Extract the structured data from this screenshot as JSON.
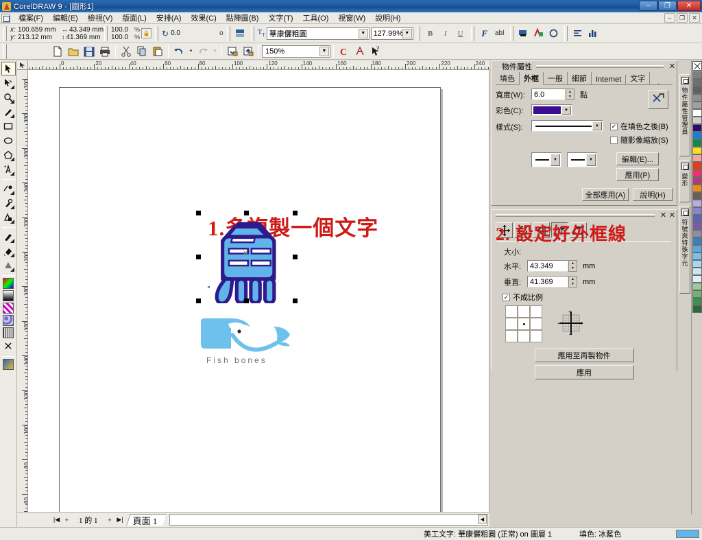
{
  "window": {
    "title": "CorelDRAW 9 - [圖形1]",
    "minimize": "–",
    "restore": "❐",
    "close": "✕",
    "mdi_minimize": "–",
    "mdi_restore": "❐",
    "mdi_close": "✕"
  },
  "menu": {
    "items": [
      {
        "label": "檔案(F)"
      },
      {
        "label": "編輯(E)"
      },
      {
        "label": "檢視(V)"
      },
      {
        "label": "版面(L)"
      },
      {
        "label": "安排(A)"
      },
      {
        "label": "效果(C)"
      },
      {
        "label": "點陣圖(B)"
      },
      {
        "label": "文字(T)"
      },
      {
        "label": "工具(O)"
      },
      {
        "label": "視窗(W)"
      },
      {
        "label": "說明(H)"
      }
    ]
  },
  "property_bar": {
    "x_label": "x:",
    "y_label": "y:",
    "x_value": "100.659 mm",
    "y_value": "213.12 mm",
    "width_value": "43.349 mm",
    "height_value": "41.369 mm",
    "scale_h": "100.0",
    "scale_v": "100.0",
    "percent": "%",
    "rotation": "0.0",
    "degree": "o",
    "font_name": "華康儷粗圓",
    "font_size": "127.99%",
    "bold": "B",
    "italic": "I",
    "underline": "U",
    "format_text": "F",
    "edit_text": "abl",
    "dropdown": "▼"
  },
  "standard_bar": {
    "new": "new-file",
    "open": "open-file",
    "save": "save-file",
    "print": "print",
    "cut": "cut",
    "copy": "copy",
    "paste": "paste",
    "undo": "undo",
    "redo": "redo",
    "import": "import",
    "export": "export",
    "zoom_level": "150%",
    "app_launcher": "corel-apps",
    "scrapbook": "scrapbook",
    "whats_this": "whats-this"
  },
  "toolbox": {
    "tools": [
      {
        "name": "pick-tool",
        "glyph": "➤"
      },
      {
        "name": "shape-tool",
        "glyph": "⟋"
      },
      {
        "name": "zoom-tool",
        "glyph": "🔍"
      },
      {
        "name": "freehand-tool",
        "glyph": "✎"
      },
      {
        "name": "rectangle-tool",
        "glyph": "▭"
      },
      {
        "name": "ellipse-tool",
        "glyph": "◯"
      },
      {
        "name": "polygon-tool",
        "glyph": "⬠"
      },
      {
        "name": "text-tool",
        "glyph": "A"
      },
      {
        "name": "interactive-blend-tool",
        "glyph": "⬱"
      },
      {
        "name": "eyedropper-tool",
        "glyph": "⚲"
      },
      {
        "name": "interactive-transparency-tool",
        "glyph": "◰"
      },
      {
        "name": "outline-tool",
        "glyph": "✒"
      },
      {
        "name": "fill-tool",
        "glyph": "◑"
      },
      {
        "name": "interactive-fill-tool",
        "glyph": "◕"
      }
    ],
    "swatches": [
      "uniform-fill",
      "fountain-fill",
      "pattern-fill",
      "texture-fill",
      "postscript-fill",
      "no-fill",
      "color-docker"
    ]
  },
  "rulers": {
    "unit": "mm",
    "h_labels": [
      "0",
      "20",
      "40",
      "60",
      "80",
      "100",
      "120",
      "140",
      "160",
      "180",
      "200",
      "220",
      "240"
    ],
    "v_labels": [
      "300",
      "280",
      "260",
      "240",
      "220",
      "200",
      "180",
      "160",
      "140",
      "120",
      "100",
      "80",
      "60",
      "40",
      "20"
    ]
  },
  "canvas": {
    "annotation_1": "1.多複製一個文字",
    "character_object": "魚",
    "logo_caption": "Fish bones",
    "fill_color": "#62b3ea",
    "outline_color": "#2d1a8c",
    "annotation_color": "#cf1a18"
  },
  "page_nav": {
    "first": "|◀",
    "prev_add": "+",
    "counter": "1 的 1",
    "next_add": "+",
    "last": "▶|",
    "tab_label": "頁面  1",
    "scroll_left": "◀"
  },
  "object_properties": {
    "title": "物件屬性",
    "close": "✕",
    "tabs": [
      {
        "label": "填色",
        "active": false
      },
      {
        "label": "外框",
        "active": true
      },
      {
        "label": "一般",
        "active": false
      },
      {
        "label": "細節",
        "active": false
      },
      {
        "label": "Internet",
        "active": false
      },
      {
        "label": "文字",
        "active": false
      }
    ],
    "width_label": "寬度(W):",
    "width_value": "6.0",
    "width_unit": "點",
    "color_label": "彩色(C):",
    "color_value": "#3b0e8f",
    "style_label": "樣式(S):",
    "checkbox_behind": "在填色之後(B)",
    "checkbox_behind_checked": true,
    "checkbox_scale": "隨影像縮放(S)",
    "checkbox_scale_checked": false,
    "edit_button": "編輯(E)...",
    "apply_button": "應用(P)",
    "apply_all_button": "全部應用(A)",
    "help_button": "說明(H)",
    "annotation_2": "2. 設定好外框線"
  },
  "transform_docker": {
    "close_1": "✕",
    "close_2": "✕",
    "buttons": [
      {
        "name": "position-tool",
        "glyph": "✥"
      },
      {
        "name": "rotate-tool",
        "glyph": "↻"
      },
      {
        "name": "mirror-tool",
        "glyph": "◁"
      },
      {
        "name": "size-tool",
        "glyph": "⬚"
      },
      {
        "name": "skew-tool",
        "glyph": "▱"
      }
    ],
    "size_label": "大小:",
    "h_label": "水平:",
    "h_value": "43.349",
    "h_unit": "mm",
    "v_label": "垂直:",
    "v_value": "41.369",
    "v_unit": "mm",
    "nonproportional_label": "不成比例",
    "nonproportional_checked": true,
    "apply_duplicate_button": "應用至再製物件",
    "apply_button": "應用"
  },
  "vertical_tabs": [
    {
      "label": "物件屬性管理員"
    },
    {
      "label": "變形"
    },
    {
      "label": "符號與特殊字元"
    }
  ],
  "status_bar": {
    "object_info": "美工文字: 華康儷粗圓 (正常) on 圖層 1",
    "fill_label": "填色: 冰藍色",
    "fill_swatch": "#63b5e5"
  },
  "palette": {
    "colors": [
      "#808080",
      "#707070",
      "#606060",
      "#909090",
      "#a0a0a0",
      "#ffffff",
      "#d0d0d0",
      "#2d0a6e",
      "#1a7fd4",
      "#0f8a46",
      "#f2e418",
      "#f5a3a3",
      "#ea3c12",
      "#e8336e",
      "#b03a7a",
      "#f08a1c",
      "#6b5d4f",
      "#b4aee0",
      "#8a84c8",
      "#5b62b8",
      "#7a5ba8",
      "#8c8ca8",
      "#3d7fb8",
      "#5aa8d8",
      "#78c0e8",
      "#a8d8ee",
      "#c8e8f4",
      "#e0f0fa",
      "#9ec9a0",
      "#6fb36f",
      "#3f8f4f",
      "#2a6b3a"
    ]
  }
}
